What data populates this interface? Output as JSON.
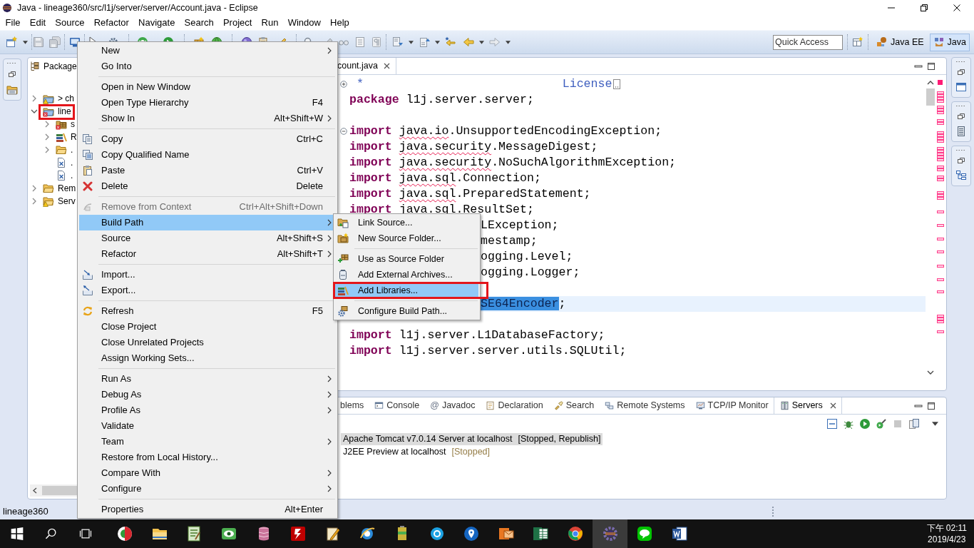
{
  "window": {
    "title": "Java - lineage360/src/l1j/server/server/Account.java - Eclipse"
  },
  "menu_bar": [
    "File",
    "Edit",
    "Source",
    "Refactor",
    "Navigate",
    "Search",
    "Project",
    "Run",
    "Window",
    "Help"
  ],
  "toolbar": {
    "quick_access": {
      "placeholder": "Quick Access"
    },
    "perspectives": [
      {
        "label": "Java EE",
        "selected": false
      },
      {
        "label": "Java",
        "selected": true
      }
    ]
  },
  "package_explorer": {
    "tab": "Package",
    "tree": [
      {
        "label": "> ch",
        "kind": "project",
        "warning": true,
        "expanded": false,
        "annotated": false
      },
      {
        "label": "line",
        "kind": "project",
        "error": true,
        "expanded": true,
        "annotated": true,
        "children": [
          {
            "label": "s",
            "kind": "source-folder",
            "error": true,
            "expanded": false,
            "annotated": false
          },
          {
            "label": "R",
            "kind": "library",
            "expanded": false,
            "annotated": false
          },
          {
            "label": ".",
            "kind": "folder",
            "expanded": false,
            "annotated": false
          },
          {
            "label": ".",
            "kind": "file",
            "annotated": false
          },
          {
            "label": ".",
            "kind": "file",
            "annotated": false
          }
        ]
      },
      {
        "label": "Rem",
        "kind": "folder",
        "expanded": false,
        "annotated": false
      },
      {
        "label": "Serv",
        "kind": "folder",
        "warning": true,
        "expanded": false,
        "annotated": false
      }
    ]
  },
  "editor": {
    "tab": {
      "label": "count.java"
    },
    "lines": [
      {
        "collapsed": true,
        "selected": false,
        "parts": [
          {
            "kind": "comment",
            "text": " *                            License"
          }
        ]
      },
      {
        "selected": false,
        "parts": [
          {
            "kind": "keyword",
            "text": "package"
          },
          {
            "kind": "plain",
            "text": "l1j.server.server;"
          }
        ]
      },
      {
        "selected": false
      },
      {
        "collapsed": false,
        "selected": false,
        "parts": [
          {
            "kind": "keyword",
            "text": "import"
          },
          {
            "kind": "flagged",
            "text": "java.io"
          },
          {
            "kind": "plain",
            "text": ".UnsupportedEncodingException;"
          }
        ]
      },
      {
        "selected": false,
        "parts": [
          {
            "kind": "keyword",
            "text": "import"
          },
          {
            "kind": "flagged",
            "text": "java.security"
          },
          {
            "kind": "plain",
            "text": ".MessageDigest;"
          }
        ]
      },
      {
        "selected": false,
        "parts": [
          {
            "kind": "keyword",
            "text": "import"
          },
          {
            "kind": "flagged",
            "text": "java.security"
          },
          {
            "kind": "plain",
            "text": ".NoSuchAlgorithmException;"
          }
        ]
      },
      {
        "selected": false,
        "parts": [
          {
            "kind": "keyword",
            "text": "import"
          },
          {
            "kind": "flagged",
            "text": "java.sql"
          },
          {
            "kind": "plain",
            "text": ".Connection;"
          }
        ]
      },
      {
        "selected": false,
        "parts": [
          {
            "kind": "keyword",
            "text": "import"
          },
          {
            "kind": "flagged",
            "text": "java.sql"
          },
          {
            "kind": "plain",
            "text": ".PreparedStatement;"
          }
        ]
      },
      {
        "selected": false,
        "parts": [
          {
            "kind": "keyword",
            "text": "import"
          },
          {
            "kind": "flagged",
            "text": "java.sql"
          },
          {
            "kind": "plain",
            "text": ".ResultSet;"
          }
        ]
      },
      {
        "covered": true,
        "selected": false,
        "parts": [
          {
            "kind": "plain",
            "text": "LException;"
          }
        ]
      },
      {
        "covered": true,
        "selected": false,
        "parts": [
          {
            "kind": "plain",
            "text": "mestamp;"
          }
        ]
      },
      {
        "covered": true,
        "selected": false,
        "parts": [
          {
            "kind": "plain",
            "text": "ogging.Level;"
          }
        ]
      },
      {
        "covered": true,
        "selected": false,
        "parts": [
          {
            "kind": "plain",
            "text": "ogging.Logger;"
          }
        ]
      },
      {
        "selected": false
      },
      {
        "covered": true,
        "selected": true,
        "parts": [
          {
            "kind": "selection",
            "text": "SE64Encoder"
          },
          {
            "kind": "plain",
            "text": ";"
          }
        ]
      },
      {
        "selected": false
      },
      {
        "selected": false,
        "parts": [
          {
            "kind": "keyword",
            "text": "import"
          },
          {
            "kind": "plain",
            "text": "l1j.server.L1DatabaseFactory;"
          }
        ]
      },
      {
        "selected": false,
        "parts": [
          {
            "kind": "keyword",
            "text": "import"
          },
          {
            "kind": "plain",
            "text": "l1j.server.server.utils.SQLUtil;"
          }
        ]
      },
      {
        "selected": false
      }
    ]
  },
  "bottom_panel": {
    "tabs": [
      {
        "label": "blems",
        "selected": false
      },
      {
        "label": "Console",
        "selected": false
      },
      {
        "label": "Javadoc",
        "glyph": "@",
        "selected": false
      },
      {
        "label": "Declaration",
        "selected": false
      },
      {
        "label": "Search",
        "selected": false
      },
      {
        "label": "Remote Systems",
        "selected": false
      },
      {
        "label": "TCP/IP Monitor",
        "selected": false
      },
      {
        "label": "Servers",
        "selected": true
      }
    ],
    "servers": [
      {
        "name": "Apache Tomcat v7.0.14 Server at localhost",
        "status": "[Stopped, Republish]",
        "selected": true
      },
      {
        "name": "J2EE Preview at localhost",
        "status": "[Stopped]",
        "selected": false
      }
    ]
  },
  "status_bar": {
    "text": "lineage360"
  },
  "context_menu": {
    "items": [
      {
        "kind": "item",
        "label": "New",
        "arrow": true,
        "selected": false,
        "disabled": false
      },
      {
        "kind": "item",
        "label": "Go Into",
        "arrow": false,
        "selected": false,
        "disabled": false
      },
      {
        "kind": "separator"
      },
      {
        "kind": "item",
        "label": "Open in New Window",
        "arrow": false,
        "selected": false,
        "disabled": false
      },
      {
        "kind": "item",
        "label": "Open Type Hierarchy",
        "shortcut": "F4",
        "arrow": false,
        "selected": false,
        "disabled": false
      },
      {
        "kind": "item",
        "label": "Show In",
        "shortcut": "Alt+Shift+W",
        "arrow": true,
        "selected": false,
        "disabled": false
      },
      {
        "kind": "separator"
      },
      {
        "kind": "item",
        "label": "Copy",
        "shortcut": "Ctrl+C",
        "arrow": false,
        "selected": false,
        "disabled": false
      },
      {
        "kind": "item",
        "label": "Copy Qualified Name",
        "arrow": false,
        "selected": false,
        "disabled": false
      },
      {
        "kind": "item",
        "label": "Paste",
        "shortcut": "Ctrl+V",
        "arrow": false,
        "selected": false,
        "disabled": false
      },
      {
        "kind": "item",
        "label": "Delete",
        "shortcut": "Delete",
        "arrow": false,
        "selected": false,
        "disabled": false
      },
      {
        "kind": "separator"
      },
      {
        "kind": "item",
        "label": "Remove from Context",
        "shortcut": "Ctrl+Alt+Shift+Down",
        "arrow": false,
        "selected": false,
        "disabled": true
      },
      {
        "kind": "item",
        "label": "Build Path",
        "arrow": true,
        "selected": true,
        "disabled": false
      },
      {
        "kind": "item",
        "label": "Source",
        "shortcut": "Alt+Shift+S",
        "arrow": true,
        "selected": false,
        "disabled": false
      },
      {
        "kind": "item",
        "label": "Refactor",
        "shortcut": "Alt+Shift+T",
        "arrow": true,
        "selected": false,
        "disabled": false
      },
      {
        "kind": "separator"
      },
      {
        "kind": "item",
        "label": "Import...",
        "arrow": false,
        "selected": false,
        "disabled": false
      },
      {
        "kind": "item",
        "label": "Export...",
        "arrow": false,
        "selected": false,
        "disabled": false
      },
      {
        "kind": "separator"
      },
      {
        "kind": "item",
        "label": "Refresh",
        "shortcut": "F5",
        "arrow": false,
        "selected": false,
        "disabled": false
      },
      {
        "kind": "item",
        "label": "Close Project",
        "arrow": false,
        "selected": false,
        "disabled": false
      },
      {
        "kind": "item",
        "label": "Close Unrelated Projects",
        "arrow": false,
        "selected": false,
        "disabled": false
      },
      {
        "kind": "item",
        "label": "Assign Working Sets...",
        "arrow": false,
        "selected": false,
        "disabled": false
      },
      {
        "kind": "separator"
      },
      {
        "kind": "item",
        "label": "Run As",
        "arrow": true,
        "selected": false,
        "disabled": false
      },
      {
        "kind": "item",
        "label": "Debug As",
        "arrow": true,
        "selected": false,
        "disabled": false
      },
      {
        "kind": "item",
        "label": "Profile As",
        "arrow": true,
        "selected": false,
        "disabled": false
      },
      {
        "kind": "item",
        "label": "Validate",
        "arrow": false,
        "selected": false,
        "disabled": false
      },
      {
        "kind": "item",
        "label": "Team",
        "arrow": true,
        "selected": false,
        "disabled": false
      },
      {
        "kind": "item",
        "label": "Restore from Local History...",
        "arrow": false,
        "selected": false,
        "disabled": false
      },
      {
        "kind": "item",
        "label": "Compare With",
        "arrow": true,
        "selected": false,
        "disabled": false
      },
      {
        "kind": "item",
        "label": "Configure",
        "arrow": true,
        "selected": false,
        "disabled": false
      },
      {
        "kind": "separator"
      },
      {
        "kind": "item",
        "label": "Properties",
        "shortcut": "Alt+Enter",
        "arrow": false,
        "selected": false,
        "disabled": false
      }
    ]
  },
  "submenu": {
    "items": [
      {
        "kind": "item",
        "label": "Link Source...",
        "selected": false,
        "annotated": false
      },
      {
        "kind": "item",
        "label": "New Source Folder...",
        "selected": false,
        "annotated": false
      },
      {
        "kind": "separator"
      },
      {
        "kind": "item",
        "label": "Use as Source Folder",
        "selected": false,
        "annotated": false
      },
      {
        "kind": "item",
        "label": "Add External Archives...",
        "selected": false,
        "annotated": false
      },
      {
        "kind": "item",
        "label": "Add Libraries...",
        "selected": true,
        "annotated": true
      },
      {
        "kind": "separator"
      },
      {
        "kind": "item",
        "label": "Configure Build Path...",
        "selected": false,
        "annotated": false
      }
    ]
  },
  "taskbar": {
    "apps": [
      {
        "selected": false
      },
      {
        "selected": false
      },
      {
        "selected": false
      },
      {
        "selected": false
      },
      {
        "selected": false
      },
      {
        "selected": false
      },
      {
        "selected": false
      },
      {
        "selected": false
      },
      {
        "selected": false
      },
      {
        "selected": false
      },
      {
        "selected": false
      },
      {
        "selected": false
      },
      {
        "selected": false
      },
      {
        "selected": false
      },
      {
        "selected": true
      },
      {
        "selected": false
      },
      {
        "selected": false
      }
    ],
    "clock": {
      "time": "下午 02:11",
      "date": "2019/4/23"
    }
  }
}
